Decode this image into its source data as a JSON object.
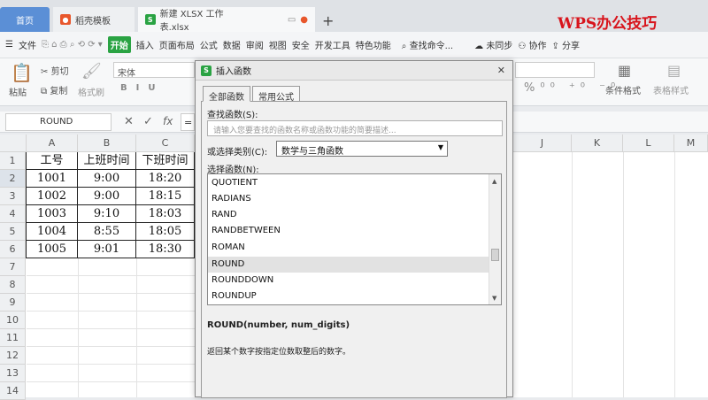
{
  "watermark": "WPS办公技巧",
  "tabs": [
    {
      "label": "首页"
    },
    {
      "label": "稻壳模板"
    },
    {
      "label": "新建 XLSX 工作表.xlsx"
    }
  ],
  "new_tab": "+",
  "menu": {
    "file": "文件",
    "items": [
      "开始",
      "插入",
      "页面布局",
      "公式",
      "数据",
      "审阅",
      "视图",
      "安全",
      "开发工具",
      "特色功能"
    ],
    "search": "查找命令...",
    "sync": "未同步",
    "collab": "协作",
    "share": "分享"
  },
  "ribbon": {
    "paste": "粘贴",
    "cut": "剪切",
    "copy": "复制",
    "format_painter": "格式刷",
    "font": "宋体",
    "cond_format": "条件格式",
    "table_style": "表格样式"
  },
  "namebox": "ROUND",
  "fx": "fx",
  "columns": [
    "A",
    "B",
    "C",
    "J",
    "K",
    "L",
    "M"
  ],
  "rows": [
    "1",
    "2",
    "3",
    "4",
    "5",
    "6",
    "7",
    "8",
    "9",
    "10",
    "11",
    "12",
    "13",
    "14",
    "15"
  ],
  "table": {
    "headers": [
      "工号",
      "上班时间",
      "下班时间"
    ],
    "rows": [
      [
        "1001",
        "9:00",
        "18:20"
      ],
      [
        "1002",
        "9:00",
        "18:15"
      ],
      [
        "1003",
        "9:10",
        "18:03"
      ],
      [
        "1004",
        "8:55",
        "18:05"
      ],
      [
        "1005",
        "9:01",
        "18:30"
      ]
    ]
  },
  "dialog": {
    "title": "插入函数",
    "tab_all": "全部函数",
    "tab_common": "常用公式",
    "search_label": "查找函数(S):",
    "search_placeholder": "请输入您要查找的函数名称或函数功能的简要描述...",
    "category_label": "或选择类别(C):",
    "category_value": "数学与三角函数",
    "select_label": "选择函数(N):",
    "functions": [
      "QUOTIENT",
      "RADIANS",
      "RAND",
      "RANDBETWEEN",
      "ROMAN",
      "ROUND",
      "ROUNDDOWN",
      "ROUNDUP"
    ],
    "selected_index": 5,
    "signature": "ROUND(number, num_digits)",
    "description": "返回某个数字按指定位数取整后的数字。"
  }
}
